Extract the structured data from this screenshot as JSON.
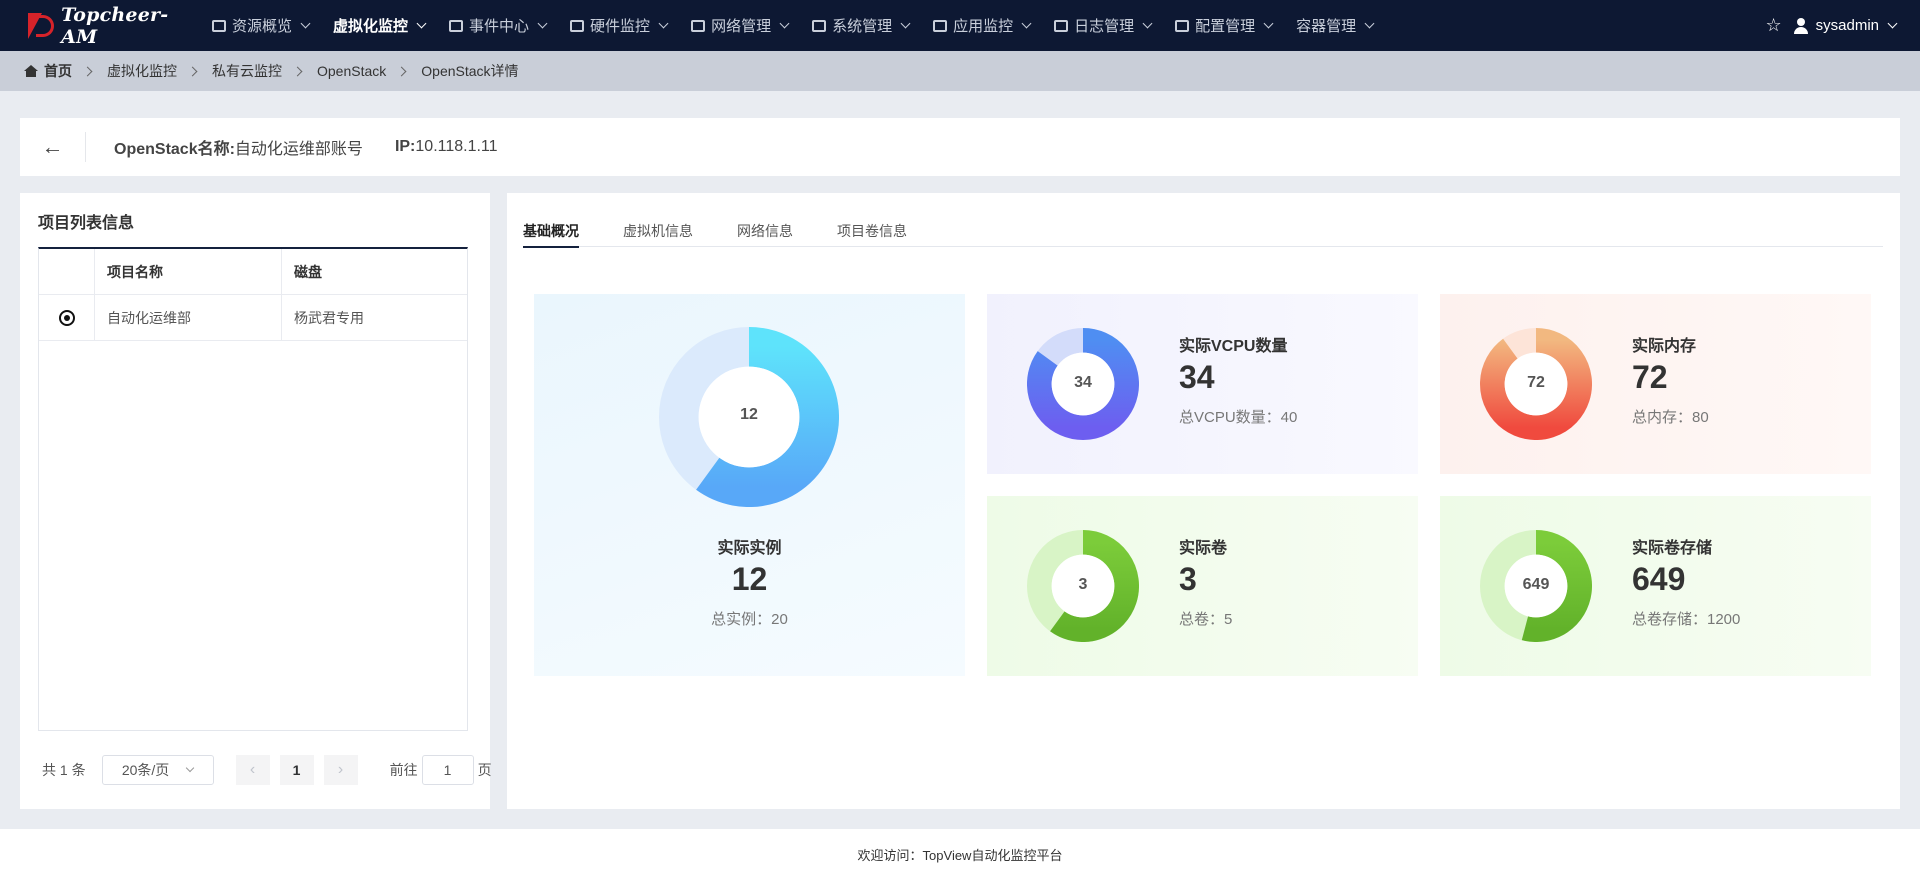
{
  "brand": {
    "logo_text": "Topcheer-AM"
  },
  "nav": {
    "items": [
      {
        "label": "资源概览",
        "icon": "monitor-icon",
        "active": false
      },
      {
        "label": "虚拟化监控",
        "icon": "",
        "active": true
      },
      {
        "label": "事件中心",
        "icon": "document-icon",
        "active": false
      },
      {
        "label": "硬件监控",
        "icon": "server-icon",
        "active": false
      },
      {
        "label": "网络管理",
        "icon": "network-icon",
        "active": false
      },
      {
        "label": "系统管理",
        "icon": "grid-icon",
        "active": false
      },
      {
        "label": "应用监控",
        "icon": "app-icon",
        "active": false
      },
      {
        "label": "日志管理",
        "icon": "log-icon",
        "active": false
      },
      {
        "label": "配置管理",
        "icon": "config-icon",
        "active": false
      },
      {
        "label": "容器管理",
        "icon": "",
        "active": false
      }
    ],
    "user": "sysadmin"
  },
  "breadcrumb": [
    "首页",
    "虚拟化监控",
    "私有云监控",
    "OpenStack",
    "OpenStack详情"
  ],
  "header": {
    "name_label": "OpenStack名称:",
    "name_value": "自动化运维部账号",
    "ip_label": "IP:",
    "ip_value": " 10.118.1.11"
  },
  "project_panel": {
    "title": "项目列表信息",
    "columns": [
      "项目名称",
      "磁盘"
    ],
    "rows": [
      {
        "name": "自动化运维部",
        "disk": "杨武君专用",
        "selected": true
      }
    ],
    "pager": {
      "total": "共 1 条",
      "page_size": "20条/页",
      "current_page": "1",
      "goto_label": "前往",
      "goto_value": "1",
      "goto_suffix": "页"
    }
  },
  "tabs": [
    "基础概况",
    "虚拟机信息",
    "网络信息",
    "项目卷信息"
  ],
  "stats": {
    "instances": {
      "label": "实际实例",
      "value": 12,
      "total_label": "总实例：20",
      "total": 20,
      "colors": [
        "#5ee3fb",
        "#58a8f8"
      ],
      "track": "#dbeafc"
    },
    "vcpu": {
      "label": "实际VCPU数量",
      "value": 34,
      "total_label": "总VCPU数量：40",
      "total": 40,
      "colors": [
        "#4f8ef2",
        "#6d5ef0"
      ],
      "track": "#d3dcfa"
    },
    "memory": {
      "label": "实际内存",
      "value": 72,
      "total_label": "总内存：80",
      "total": 80,
      "colors": [
        "#f2b880",
        "#f04a3e"
      ],
      "track": "#fde4d8"
    },
    "volumes": {
      "label": "实际卷",
      "value": 3,
      "total_label": "总卷：5",
      "total": 5,
      "colors": [
        "#7ccc3a",
        "#62b22a"
      ],
      "track": "#d8f4c6"
    },
    "volume_storage": {
      "label": "实际卷存储",
      "value": 649,
      "total_label": "总卷存储：1200",
      "total": 1200,
      "colors": [
        "#7ccc3a",
        "#62b22a"
      ],
      "track": "#d8f4c6"
    }
  },
  "footer": "欢迎访问：TopView自动化监控平台"
}
